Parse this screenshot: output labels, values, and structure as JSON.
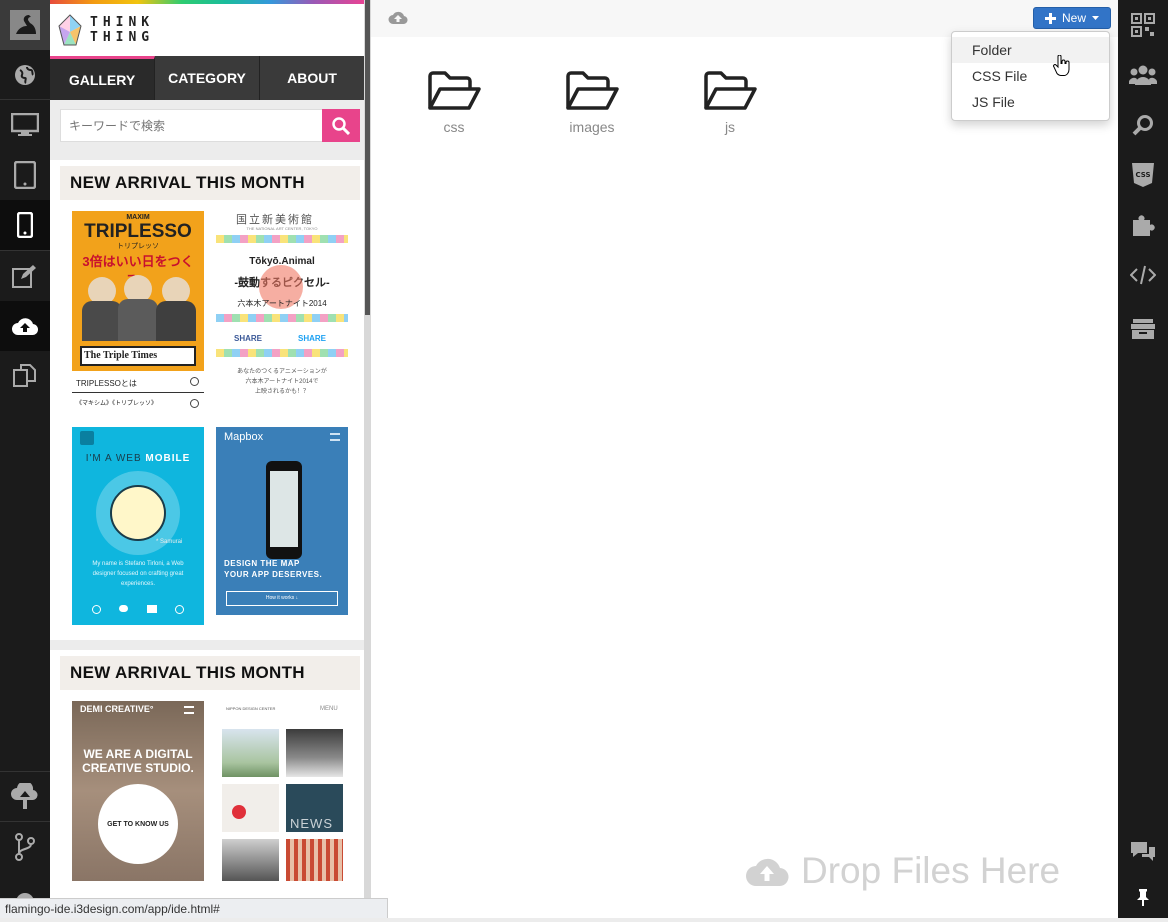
{
  "preview": {
    "brand": {
      "line1": "THINK",
      "line2": "THING"
    },
    "nav": [
      {
        "label": "GALLERY"
      },
      {
        "label": "CATEGORY"
      },
      {
        "label": "ABOUT"
      }
    ],
    "search": {
      "placeholder": "キーワードで検索"
    },
    "sections": [
      {
        "title": "NEW ARRIVAL THIS MONTH"
      },
      {
        "title": "NEW ARRIVAL THIS MONTH"
      }
    ],
    "cards": {
      "triplesso": {
        "brand": "MAXIM",
        "title": "TRIPLESSO",
        "sub": "トリプレッソ",
        "tagline": "3倍はいい日をつくる。",
        "paper": "The Triple Times",
        "link1": "TRIPLESSOとは",
        "link2": "《マキシム》《トリプレッソ》"
      },
      "tokyo": {
        "header": "国立新美術館",
        "subheader": "THE NATIONAL ART CENTER, TOKYO",
        "title": "Tōkyō.Animal",
        "line2": "-鼓動するピクセル-",
        "line3": "六本木アートナイト2014",
        "share1": "SHARE",
        "share2": "SHARE",
        "foot1": "あなたのつくるアニメーションが",
        "foot2": "六本木アートナイト2014で",
        "foot3": "上映されるかも！？"
      },
      "webmobile": {
        "title1": "I'M A WEB",
        "title2": "MOBILE",
        "caption": "* Samurai",
        "desc1": "My name is Stefano Tirloni, a Web",
        "desc2": "designer focused on crafting great",
        "desc3": "experiences."
      },
      "mapbox": {
        "brand": "Mapbox",
        "headline1": "DESIGN THE MAP",
        "headline2": "YOUR APP DESERVES.",
        "button": "How it works ↓"
      },
      "demi": {
        "brand": "DEMI CREATIVE°",
        "headline1": "WE ARE A DIGITAL",
        "headline2": "CREATIVE STUDIO.",
        "button": "GET TO KNOW US"
      },
      "nippon": {
        "brand": "NIPPON DESIGN CENTER",
        "menu": "MENU",
        "news": "NEWS"
      }
    }
  },
  "main": {
    "new_button": "New",
    "menu": [
      {
        "label": "Folder"
      },
      {
        "label": "CSS File"
      },
      {
        "label": "JS File"
      }
    ],
    "folders": [
      {
        "label": "css"
      },
      {
        "label": "images"
      },
      {
        "label": "js"
      }
    ],
    "drop_text": "Drop Files Here"
  },
  "status_url": "flamingo-ide.i3design.com/app/ide.html#",
  "colors": {
    "accent_pink": "#e8448b",
    "button_blue": "#3274c7",
    "sidebar_dark": "#1b1b1b"
  },
  "left_icons": [
    "swan-logo-icon",
    "globe-icon",
    "desktop-icon",
    "tablet-icon",
    "phone-icon",
    "edit-icon",
    "cloud-upload-icon",
    "copy-icon",
    "deploy-icon",
    "branch-icon",
    "gear-icon"
  ],
  "right_icons": [
    "qr-code-icon",
    "users-icon",
    "search-icon",
    "css-icon",
    "puzzle-icon",
    "code-icon",
    "archive-icon",
    "chat-icon",
    "pin-icon"
  ]
}
